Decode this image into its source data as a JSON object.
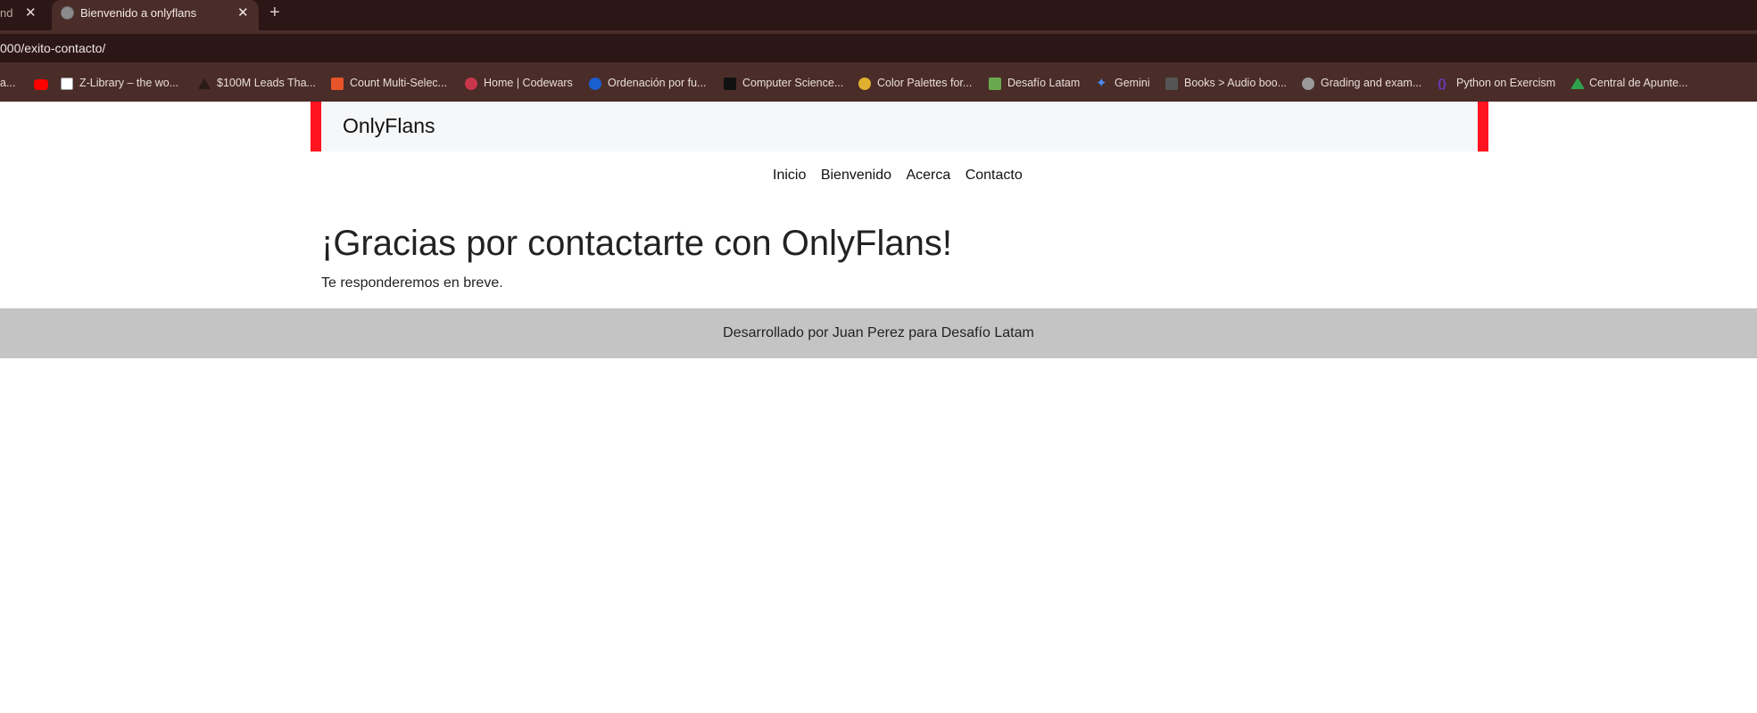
{
  "browser": {
    "inactive_tab": {
      "label": "nd",
      "close": "✕"
    },
    "active_tab": {
      "title": "Bienvenido a onlyflans",
      "close": "✕"
    },
    "new_tab": "+",
    "url": "000/exito-contacto/",
    "bookmarks": [
      {
        "label": "a...",
        "icon": "generic-icon",
        "color": "#8b8b8b"
      },
      {
        "label": "",
        "icon": "youtube-icon",
        "color": "#ff0000"
      },
      {
        "label": "Z-Library – the wo...",
        "icon": "z-library-icon",
        "color": "#ffffff"
      },
      {
        "label": "$100M Leads Tha...",
        "icon": "triangle-icon",
        "color": "#3a2a26"
      },
      {
        "label": "Count Multi-Selec...",
        "icon": "tf-icon",
        "color": "#e8542a"
      },
      {
        "label": "Home | Codewars",
        "icon": "codewars-icon",
        "color": "#c8364b"
      },
      {
        "label": "Ordenación por fu...",
        "icon": "c-icon",
        "color": "#1a5fd0"
      },
      {
        "label": "Computer Science...",
        "icon": "x-icon",
        "color": "#111111"
      },
      {
        "label": "Color Palettes for...",
        "icon": "palette-icon",
        "color": "#e0b030"
      },
      {
        "label": "Desafío Latam",
        "icon": "desafio-icon",
        "color": "#6aa84f"
      },
      {
        "label": "Gemini",
        "icon": "gemini-icon",
        "color": "#4a8cf0"
      },
      {
        "label": "Books > Audio boo...",
        "icon": "audiobooks-icon",
        "color": "#555555"
      },
      {
        "label": "Grading and exam...",
        "icon": "globe-icon",
        "color": "#9a9a9a"
      },
      {
        "label": "Python on Exercism",
        "icon": "exercism-icon",
        "color": "#6b3cc4"
      },
      {
        "label": "Central de Apunte...",
        "icon": "drive-icon",
        "color": "#2ea24f"
      }
    ]
  },
  "page": {
    "brand": "OnlyFlans",
    "nav": [
      "Inicio",
      "Bienvenido",
      "Acerca",
      "Contacto"
    ],
    "title": "¡Gracias por contactarte con OnlyFlans!",
    "subtitle": "Te responderemos en breve.",
    "footer": "Desarrollado por Juan Perez para Desafío Latam"
  },
  "colors": {
    "accent": "#ff1420",
    "header_bg": "#f6f7f9",
    "footer_bg": "#c4c4c4",
    "chrome_bg": "#2c1616"
  }
}
